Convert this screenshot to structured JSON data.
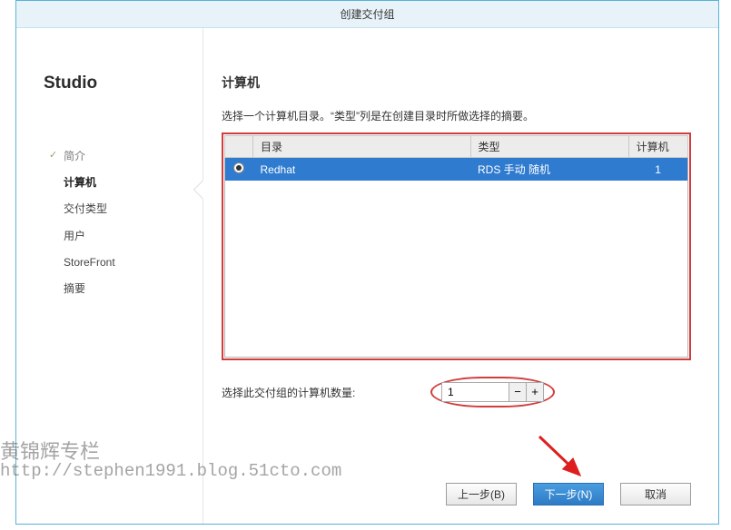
{
  "window": {
    "title": "创建交付组"
  },
  "sidebar": {
    "brand": "Studio",
    "items": [
      {
        "label": "简介",
        "state": "completed"
      },
      {
        "label": "计算机",
        "state": "current"
      },
      {
        "label": "交付类型",
        "state": "pending"
      },
      {
        "label": "用户",
        "state": "pending"
      },
      {
        "label": "StoreFront",
        "state": "pending"
      },
      {
        "label": "摘要",
        "state": "pending"
      }
    ]
  },
  "main": {
    "title": "计算机",
    "instruction": "选择一个计算机目录。“类型”列是在创建目录时所做选择的摘要。",
    "table": {
      "headers": {
        "directory": "目录",
        "type": "类型",
        "count": "计算机"
      },
      "rows": [
        {
          "selected": true,
          "directory": "Redhat",
          "type": "RDS 手动 随机",
          "count": "1"
        }
      ]
    },
    "quantity": {
      "label": "选择此交付组的计算机数量:",
      "value": "1"
    }
  },
  "footer": {
    "back": "上一步(B)",
    "next": "下一步(N)",
    "cancel": "取消"
  },
  "watermark": {
    "line1": "黄锦辉专栏",
    "line2": "http://stephen1991.blog.51cto.com"
  },
  "annotation": {
    "arrow_color": "#dd1f1f"
  }
}
